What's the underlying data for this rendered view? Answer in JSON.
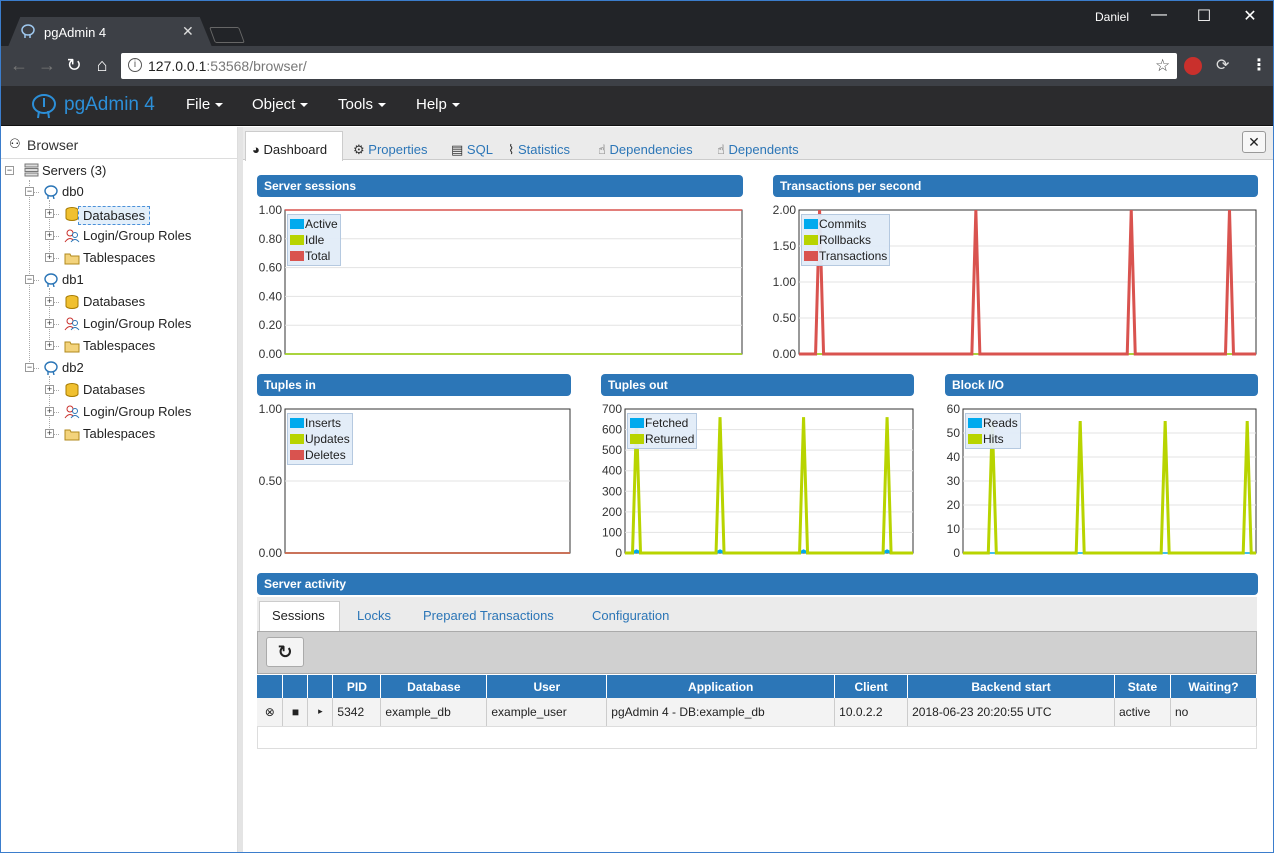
{
  "window": {
    "tab_title": "pgAdmin 4",
    "user": "Daniel",
    "url_host": "127.0.0.1",
    "url_rest": ":53568/browser/"
  },
  "app": {
    "brand": "pgAdmin 4",
    "menus": [
      "File",
      "Object",
      "Tools",
      "Help"
    ]
  },
  "browser": {
    "title": "Browser",
    "root": "Servers (3)",
    "servers": [
      {
        "name": "db0",
        "children": [
          "Databases",
          "Login/Group Roles",
          "Tablespaces"
        ]
      },
      {
        "name": "db1",
        "children": [
          "Databases",
          "Login/Group Roles",
          "Tablespaces"
        ]
      },
      {
        "name": "db2",
        "children": [
          "Databases",
          "Login/Group Roles",
          "Tablespaces"
        ]
      }
    ]
  },
  "tabs": [
    "Dashboard",
    "Properties",
    "SQL",
    "Statistics",
    "Dependencies",
    "Dependents"
  ],
  "panels": {
    "server_sessions": "Server sessions",
    "tps": "Transactions per second",
    "tuples_in": "Tuples in",
    "tuples_out": "Tuples out",
    "block_io": "Block I/O",
    "server_activity": "Server activity"
  },
  "chart_data": [
    {
      "type": "line",
      "title": "Server sessions",
      "ylim": [
        0,
        1
      ],
      "yticks": [
        "1.00",
        "0.80",
        "0.60",
        "0.40",
        "0.20",
        "0.00"
      ],
      "series": [
        {
          "name": "Active",
          "color": "#00aaee",
          "values": [
            0,
            0
          ]
        },
        {
          "name": "Idle",
          "color": "#b8d400",
          "values": [
            0,
            0
          ]
        },
        {
          "name": "Total",
          "color": "#d9534f",
          "values": [
            1,
            1
          ]
        }
      ]
    },
    {
      "type": "line",
      "title": "Transactions per second",
      "ylim": [
        0,
        2
      ],
      "yticks": [
        "2.00",
        "1.50",
        "1.00",
        "0.50",
        "0.00"
      ],
      "series": [
        {
          "name": "Commits",
          "color": "#00aaee",
          "values": []
        },
        {
          "name": "Rollbacks",
          "color": "#b8d400",
          "values": []
        },
        {
          "name": "Transactions",
          "color": "#d9534f",
          "spikes": [
            2,
            2,
            2,
            2,
            2
          ]
        }
      ]
    },
    {
      "type": "line",
      "title": "Tuples in",
      "ylim": [
        0,
        1
      ],
      "yticks": [
        "1.00",
        "0.50",
        "0.00"
      ],
      "series": [
        {
          "name": "Inserts",
          "color": "#00aaee",
          "values": [
            0,
            0
          ]
        },
        {
          "name": "Updates",
          "color": "#b8d400",
          "values": [
            0,
            0
          ]
        },
        {
          "name": "Deletes",
          "color": "#d9534f",
          "values": [
            0,
            0
          ]
        }
      ]
    },
    {
      "type": "line",
      "title": "Tuples out",
      "ylim": [
        0,
        700
      ],
      "yticks": [
        "700",
        "600",
        "500",
        "400",
        "300",
        "200",
        "100",
        "0"
      ],
      "series": [
        {
          "name": "Fetched",
          "color": "#00aaee",
          "spikes": [
            10,
            10,
            10,
            10
          ]
        },
        {
          "name": "Returned",
          "color": "#b8d400",
          "spikes": [
            650,
            660,
            660,
            660
          ]
        }
      ]
    },
    {
      "type": "line",
      "title": "Block I/O",
      "ylim": [
        0,
        60
      ],
      "yticks": [
        "60",
        "50",
        "40",
        "30",
        "20",
        "10",
        "0"
      ],
      "series": [
        {
          "name": "Reads",
          "color": "#00aaee",
          "values": [
            0,
            0
          ]
        },
        {
          "name": "Hits",
          "color": "#b8d400",
          "spikes": [
            55,
            55,
            55,
            55
          ]
        }
      ]
    }
  ],
  "activity": {
    "tabs": [
      "Sessions",
      "Locks",
      "Prepared Transactions",
      "Configuration"
    ],
    "columns": [
      "",
      "",
      "",
      "PID",
      "Database",
      "User",
      "Application",
      "Client",
      "Backend start",
      "State",
      "Waiting?"
    ],
    "rows": [
      {
        "pid": "5342",
        "database": "example_db",
        "user": "example_user",
        "application": "pgAdmin 4 - DB:example_db",
        "client": "10.0.2.2",
        "backend_start": "2018-06-23 20:20:55 UTC",
        "state": "active",
        "waiting": "no"
      }
    ]
  }
}
